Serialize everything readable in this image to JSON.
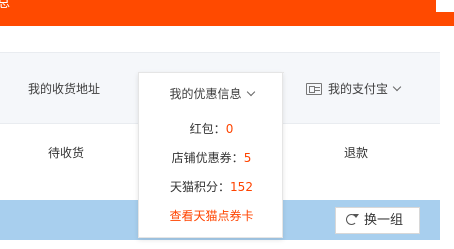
{
  "top_bar": {
    "text_fragment": "总"
  },
  "nav": {
    "address_label": "我的收货地址",
    "coupon_label": "我的优惠信息",
    "alipay_label": "我的支付宝"
  },
  "status_tabs": {
    "pending_receipt": "待收货",
    "refund": "退款"
  },
  "coupon_menu": {
    "red_packet_label": "红包：",
    "red_packet_value": "0",
    "shop_coupon_label": "店铺优惠券：",
    "shop_coupon_value": "5",
    "tmall_points_label": "天猫积分：",
    "tmall_points_value": "152",
    "view_vouchers_link": "查看天猫点券卡"
  },
  "recommend": {
    "swap_button_label": "换一组"
  },
  "colors": {
    "brand_orange": "#ff4a00",
    "value_red": "#ff4400",
    "band_blue": "#a8cfee",
    "nav_bg": "#f5f7fa"
  },
  "icons": {
    "alipay": "card-icon",
    "dropdown": "chevron-down-icon",
    "swap": "refresh-icon"
  }
}
